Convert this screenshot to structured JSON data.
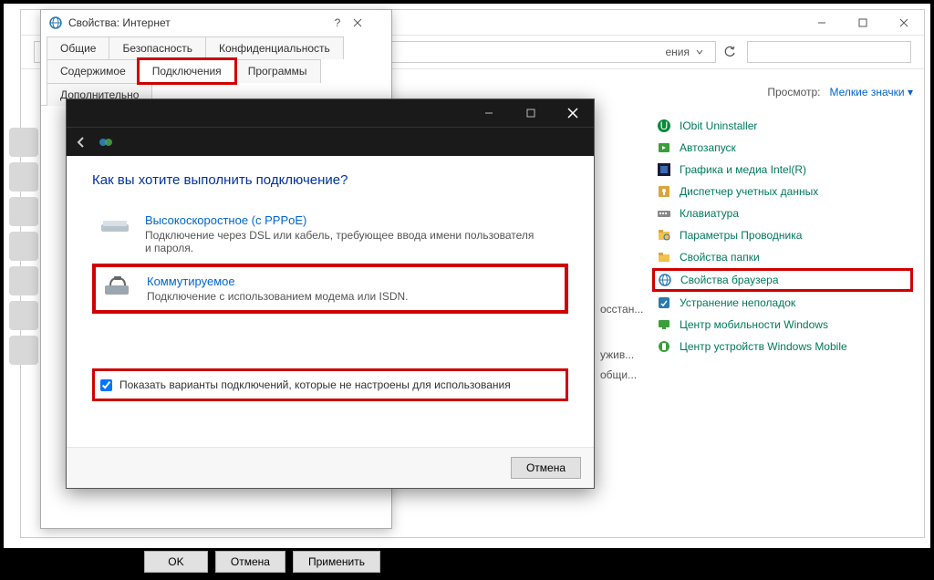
{
  "controlPanel": {
    "addressSuffix": "ения",
    "viewLabel": "Просмотр:",
    "viewMode": "Мелкие значки",
    "items": [
      {
        "icon": "iobit",
        "label": "IObit Uninstaller"
      },
      {
        "icon": "startup",
        "label": "Автозапуск"
      },
      {
        "icon": "intel",
        "label": "Графика и медиа Intel(R)"
      },
      {
        "icon": "creds",
        "label": "Диспетчер учетных данных"
      },
      {
        "icon": "keyb",
        "label": "Клавиатура"
      },
      {
        "icon": "explorer",
        "label": "Параметры Проводника"
      },
      {
        "icon": "folder",
        "label": "Свойства папки"
      },
      {
        "icon": "browser",
        "label": "Свойства браузера",
        "highlight": true
      },
      {
        "icon": "trouble",
        "label": "Устранение неполадок"
      },
      {
        "icon": "mobility",
        "label": "Центр мобильности Windows"
      },
      {
        "icon": "devices",
        "label": "Центр устройств Windows Mobile"
      }
    ],
    "leakRows": [
      "осстан...",
      "ужив...",
      "общи..."
    ]
  },
  "internetProps": {
    "title": "Свойства: Интернет",
    "tabsRow1": [
      "Общие",
      "Безопасность",
      "Конфиденциальность"
    ],
    "tabsRow2": [
      "Содержимое",
      "Подключения",
      "Программы",
      "Дополнительно"
    ],
    "activeTab": "Подключения",
    "buttons": {
      "ok": "OK",
      "cancel": "Отмена",
      "apply": "Применить"
    }
  },
  "wizard": {
    "heading": "Как вы хотите выполнить подключение?",
    "opt1": {
      "title": "Высокоскоростное (с PPPoE)",
      "desc": "Подключение через DSL или кабель, требующее ввода имени пользователя и пароля."
    },
    "opt2": {
      "title": "Коммутируемое",
      "desc": "Подключение с использованием модема или ISDN."
    },
    "checkboxLabel": "Показать варианты подключений, которые не настроены для использования",
    "checkboxChecked": true,
    "cancel": "Отмена"
  }
}
